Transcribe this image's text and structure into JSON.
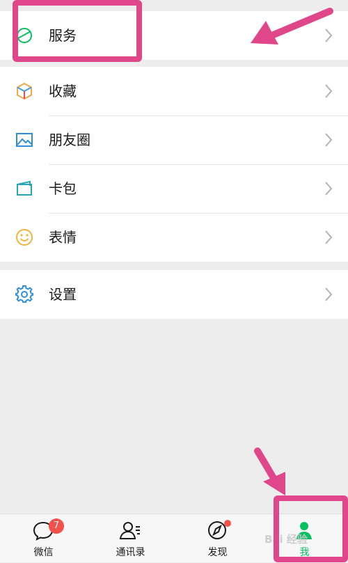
{
  "menu": {
    "service": {
      "label": "服务",
      "icon": "service-icon"
    },
    "items": [
      {
        "label": "收藏",
        "icon": "favorites-cube-icon"
      },
      {
        "label": "朋友圈",
        "icon": "moments-picture-icon"
      },
      {
        "label": "卡包",
        "icon": "card-wallet-icon"
      },
      {
        "label": "表情",
        "icon": "sticker-smile-icon"
      }
    ],
    "settings": {
      "label": "设置",
      "icon": "gear-icon"
    }
  },
  "tabbar": {
    "tabs": [
      {
        "label": "微信",
        "icon": "chat-bubble-icon",
        "badge": "7"
      },
      {
        "label": "通讯录",
        "icon": "contacts-icon"
      },
      {
        "label": "发现",
        "icon": "compass-icon"
      },
      {
        "label": "我",
        "icon": "person-icon",
        "active": true
      }
    ]
  },
  "watermark": "Bai 经验",
  "colors": {
    "accent": "#07c160",
    "badge": "#f25249",
    "highlight": "#e0478a",
    "background": "#ededed"
  }
}
